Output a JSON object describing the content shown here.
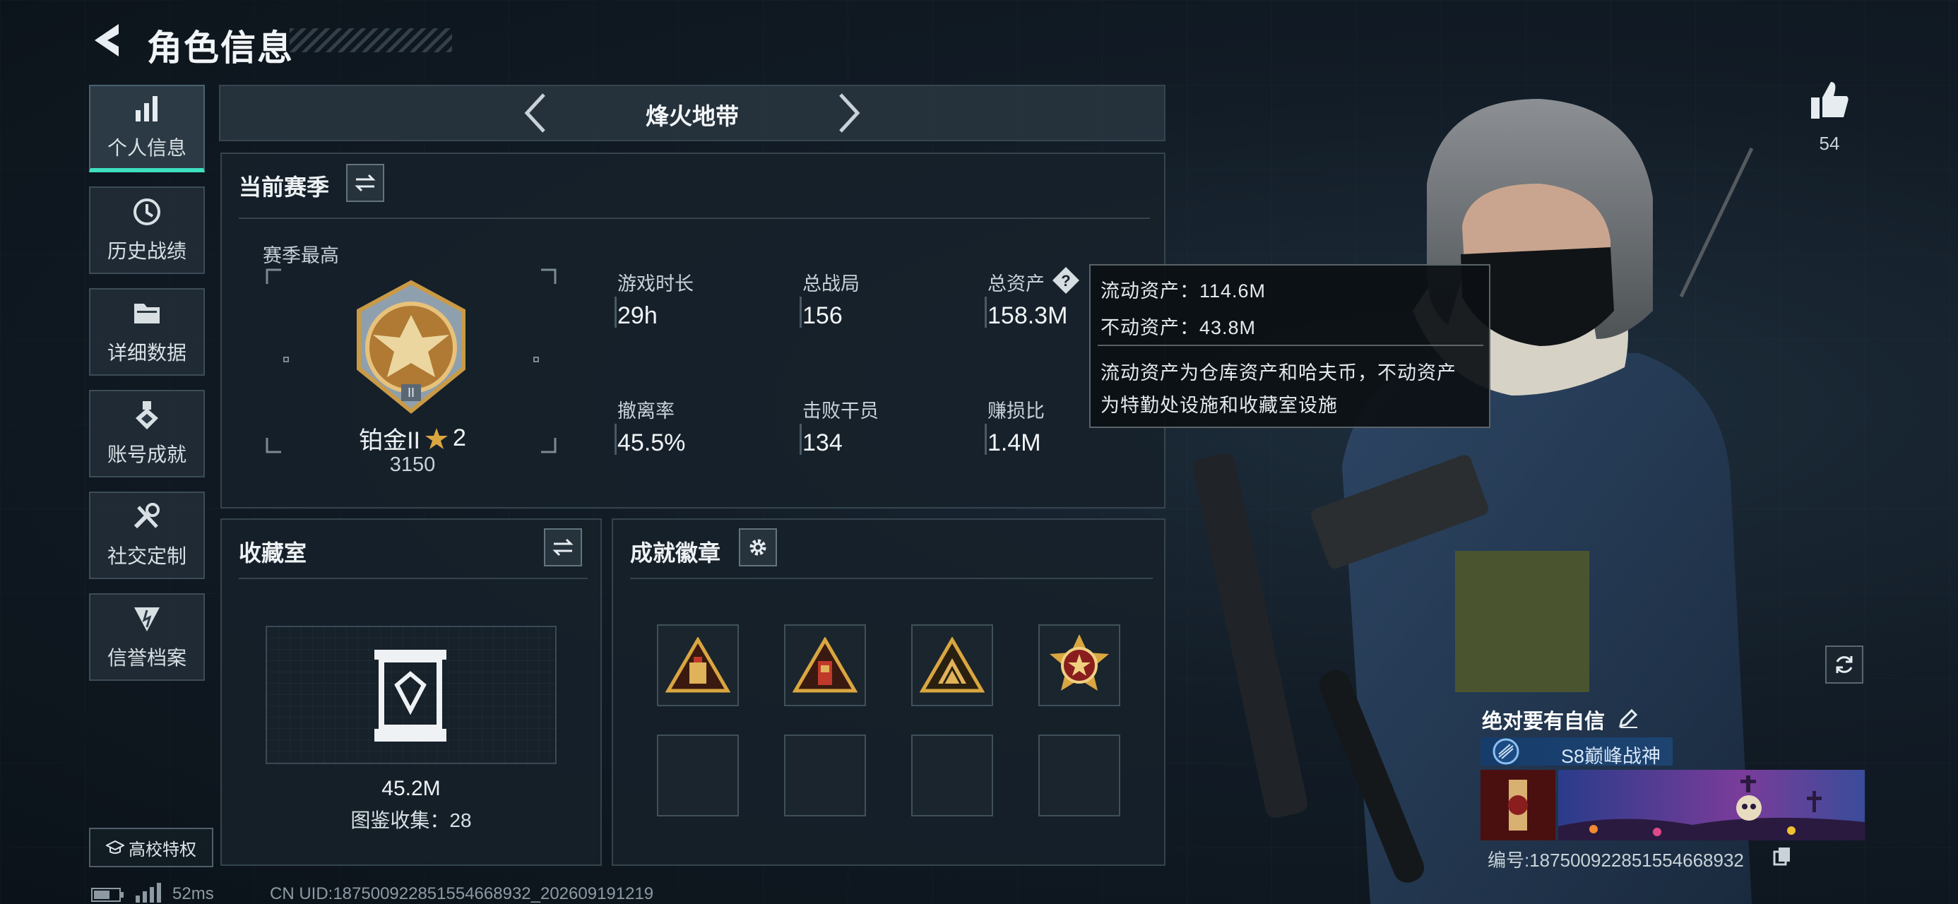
{
  "header": {
    "title": "角色信息"
  },
  "sidebar": {
    "items": [
      {
        "label": "个人信息",
        "icon": "bar-chart-icon",
        "active": true
      },
      {
        "label": "历史战绩",
        "icon": "history-icon"
      },
      {
        "label": "详细数据",
        "icon": "folder-icon"
      },
      {
        "label": "账号成就",
        "icon": "achievement-icon"
      },
      {
        "label": "社交定制",
        "icon": "tools-icon"
      },
      {
        "label": "信誉档案",
        "icon": "credit-icon"
      }
    ],
    "campus_label": "高校特权"
  },
  "mode": {
    "name": "烽火地带"
  },
  "season": {
    "title": "当前赛季",
    "best_label": "赛季最高",
    "rank_name": "铂金II",
    "rank_stars": "2",
    "rank_score": "3150",
    "stats": [
      {
        "label": "游戏时长",
        "value": "29h"
      },
      {
        "label": "总战局",
        "value": "156"
      },
      {
        "label": "总资产",
        "value": "158.3M"
      },
      {
        "label": "撤离率",
        "value": "45.5%"
      },
      {
        "label": "击败干员",
        "value": "134"
      },
      {
        "label": "赚损比",
        "value": "1.4M"
      }
    ]
  },
  "tooltip": {
    "line1": "流动资产：114.6M",
    "line2": "不动资产：43.8M",
    "line3": "流动资产为仓库资产和哈夫币，不动资产",
    "line4": "为特勤处设施和收藏室设施"
  },
  "vault": {
    "title": "收藏室",
    "value": "45.2M",
    "collection": "图鉴收集：28"
  },
  "badges": {
    "title": "成就徽章",
    "filled": [
      "warning-triangle-badge",
      "warning-triangle-badge",
      "warning-triangle-badge",
      "star-medal-badge"
    ],
    "empty_count": 4
  },
  "profile": {
    "likes": "54",
    "player_name": "绝对要有自信",
    "title": "S8巅峰战神",
    "uid_label": "编号:18750092285155466893​2"
  },
  "footer": {
    "ping": "52ms",
    "uid": "CN UID:18750092285155466893​2_202609191219"
  },
  "colors": {
    "accent": "#3ee0c0",
    "gold": "#d9a640",
    "panel": "#16212a"
  }
}
